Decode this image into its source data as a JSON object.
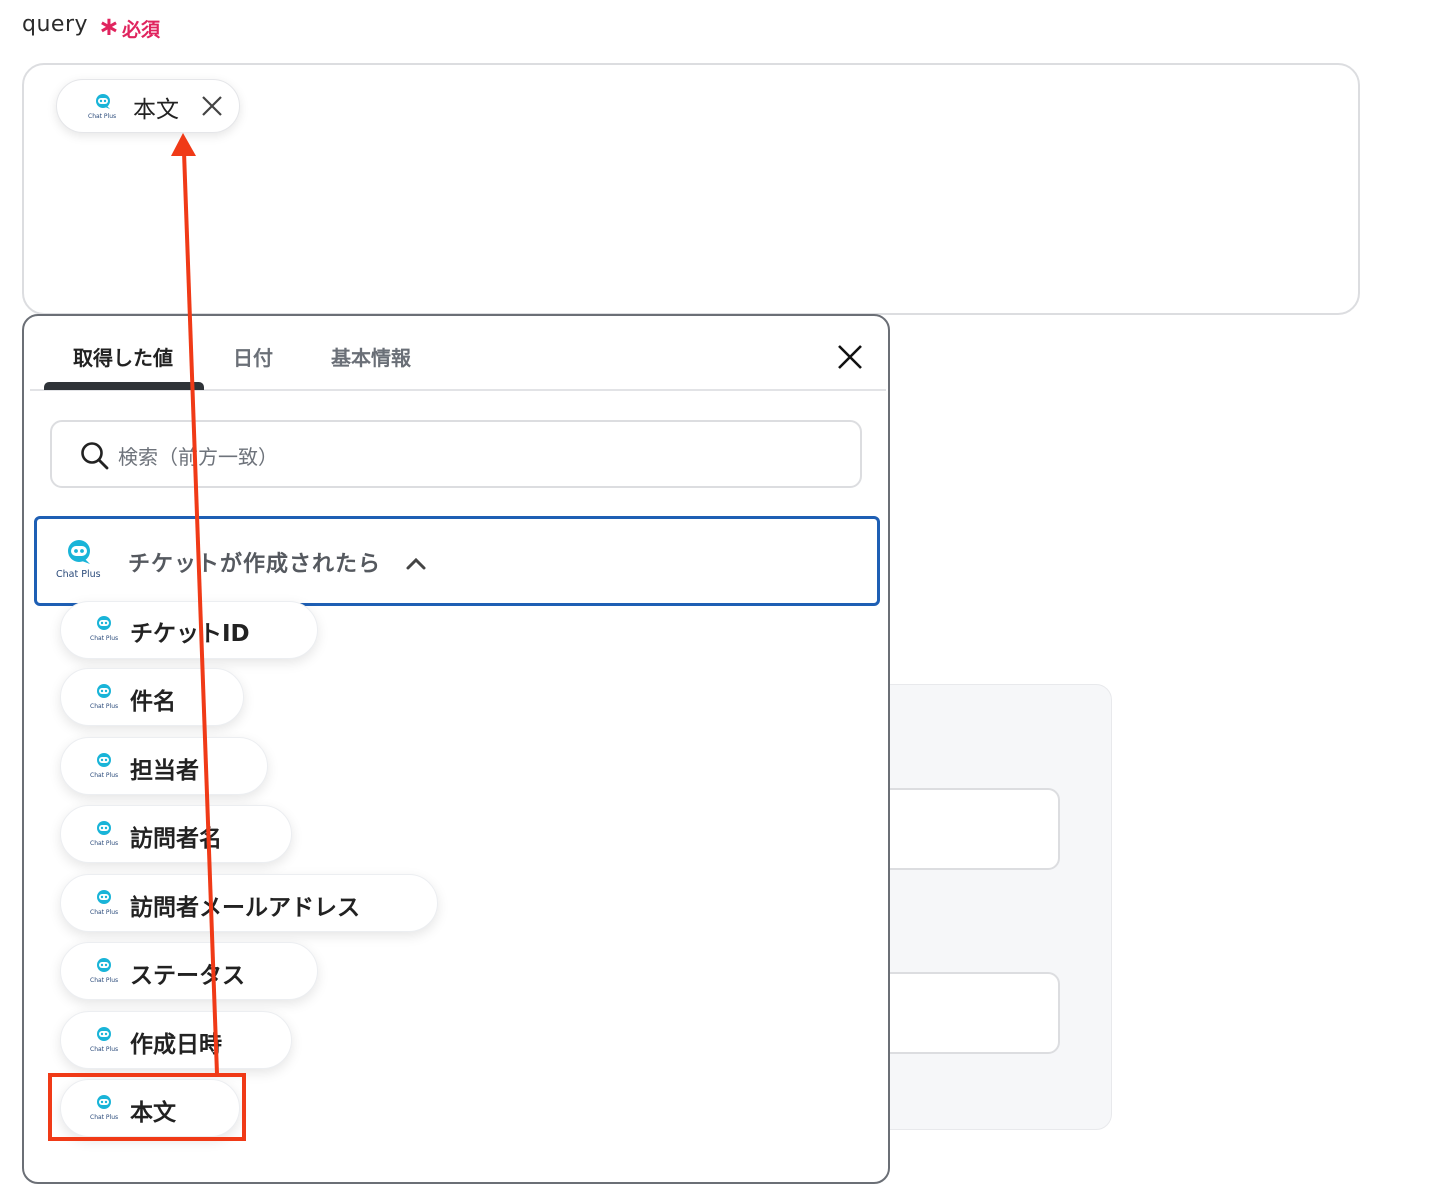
{
  "field": {
    "label": "query",
    "required_mark": "∗",
    "required_text": "必須"
  },
  "query_token": {
    "text": "本文",
    "logo": "Chat Plus"
  },
  "popup": {
    "tabs": [
      {
        "label": "取得した値",
        "active": true
      },
      {
        "label": "日付",
        "active": false
      },
      {
        "label": "基本情報",
        "active": false
      }
    ],
    "search_placeholder": "検索（前方一致）",
    "group": {
      "label": "チケットが作成されたら",
      "logo": "Chat Plus"
    },
    "items": [
      {
        "label": "チケットID"
      },
      {
        "label": "件名"
      },
      {
        "label": "担当者"
      },
      {
        "label": "訪問者名"
      },
      {
        "label": "訪問者メールアドレス"
      },
      {
        "label": "ステータス"
      },
      {
        "label": "作成日時"
      },
      {
        "label": "本文"
      }
    ]
  },
  "colors": {
    "accent_blue": "#1e5fb4",
    "required_red": "#e0245e",
    "annotation_red": "#f03a17",
    "logo_cyan": "#19b4d8"
  },
  "icons": [
    "chatplus-logo-icon",
    "close-icon",
    "search-icon",
    "chevron-up-icon"
  ]
}
